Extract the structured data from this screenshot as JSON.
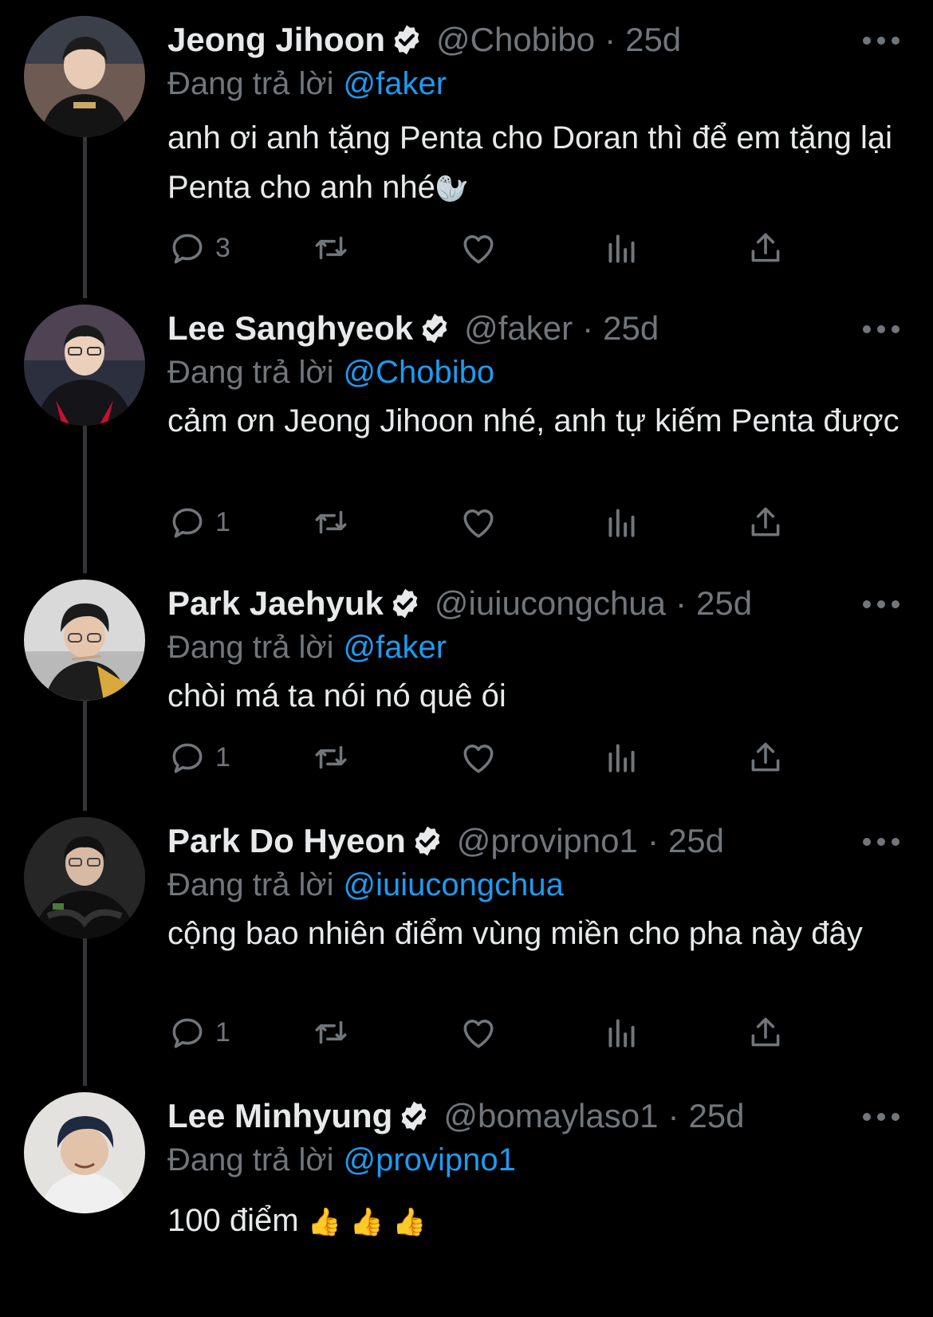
{
  "reply_prefix": "Đang trả lời",
  "colors": {
    "background": "#000000",
    "text": "#e7e9ea",
    "muted": "#71767b",
    "link": "#1d9bf0",
    "thread_line": "#333639"
  },
  "icons": [
    "verified-icon",
    "more-icon",
    "reply-icon",
    "retweet-icon",
    "like-icon",
    "views-icon",
    "share-icon"
  ],
  "tweets": [
    {
      "name": "Jeong Jihoon",
      "handle": "@Chobibo",
      "time": "25d",
      "reply_to": "@faker",
      "text": "anh ơi anh tặng Penta cho Doran thì để em tặng lại Penta cho anh nhé",
      "emoji": "🦭",
      "replies": "3"
    },
    {
      "name": "Lee Sanghyeok",
      "handle": "@faker",
      "time": "25d",
      "reply_to": "@Chobibo",
      "text": "cảm ơn Jeong Jihoon nhé, anh tự kiếm Penta được",
      "replies": "1"
    },
    {
      "name": "Park Jaehyuk",
      "handle": "@iuiucongchua",
      "time": "25d",
      "reply_to": "@faker",
      "text": "chòi má ta nói nó quê ói",
      "replies": "1"
    },
    {
      "name": "Park Do Hyeon",
      "handle": "@provipno1",
      "time": "25d",
      "reply_to": "@iuiucongchua",
      "text": "cộng bao nhiên điểm vùng miền cho pha này đây",
      "replies": "1"
    },
    {
      "name": "Lee Minhyung",
      "handle": "@bomaylaso1",
      "time": "25d",
      "reply_to": "@provipno1",
      "text": "100 điểm",
      "emoji": "👍 👍 👍"
    }
  ]
}
